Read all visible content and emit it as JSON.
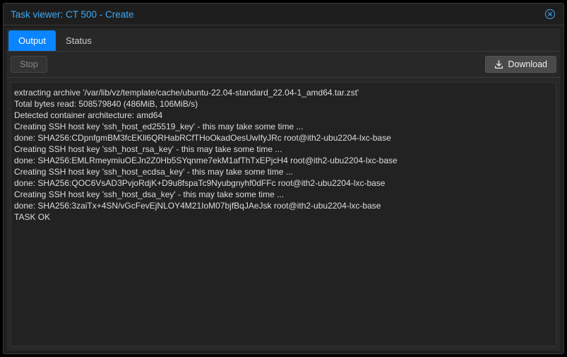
{
  "header": {
    "title": "Task viewer: CT 500 - Create"
  },
  "tabs": [
    {
      "label": "Output",
      "active": true
    },
    {
      "label": "Status",
      "active": false
    }
  ],
  "toolbar": {
    "stop_label": "Stop",
    "download_label": "Download"
  },
  "log_lines": [
    "extracting archive '/var/lib/vz/template/cache/ubuntu-22.04-standard_22.04-1_amd64.tar.zst'",
    "Total bytes read: 508579840 (486MiB, 106MiB/s)",
    "Detected container architecture: amd64",
    "Creating SSH host key 'ssh_host_ed25519_key' - this may take some time ...",
    "done: SHA256:CDpnfgmBM3fcEKll6QRHabRCfTHoOkadOesUwIfyJRc root@ith2-ubu2204-lxc-base",
    "Creating SSH host key 'ssh_host_rsa_key' - this may take some time ...",
    "done: SHA256:EMLRmeymiuOEJn2Z0Hb5SYqnme7ekM1afThTxEPjcH4 root@ith2-ubu2204-lxc-base",
    "Creating SSH host key 'ssh_host_ecdsa_key' - this may take some time ...",
    "done: SHA256:QOC6VsAD3PvjoRdjK+D9u8fspaTc9Nyubgnyhf0dFFc root@ith2-ubu2204-lxc-base",
    "Creating SSH host key 'ssh_host_dsa_key' - this may take some time ...",
    "done: SHA256:3zaiTx+4SN/vGcFevEjNLOY4M21IoM07bjfBqJAeJsk root@ith2-ubu2204-lxc-base",
    "TASK OK"
  ]
}
